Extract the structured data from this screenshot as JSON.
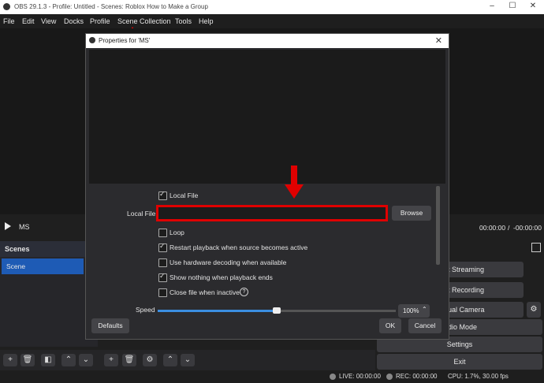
{
  "window": {
    "title": "OBS 29.1.3 - Profile: Untitled - Scenes: Roblox How to Make a Group",
    "min": "–",
    "max": "☐",
    "close": "✕"
  },
  "menubar": [
    "File",
    "Edit",
    "View",
    "Docks",
    "Profile",
    "Scene Collection",
    "Tools",
    "Help"
  ],
  "playbar": {
    "source": "MS",
    "time": "00:00:00",
    "sep": "/",
    "duration": "-00:00:00"
  },
  "scenes": {
    "header": "Scenes",
    "items": [
      "Scene"
    ]
  },
  "controls": {
    "start_streaming": "t Streaming",
    "start_recording": "t Recording",
    "virtual_camera": "ual Camera",
    "studio_mode": "udio Mode",
    "settings": "Settings",
    "exit": "Exit"
  },
  "status": {
    "live": "LIVE: 00:00:00",
    "rec": "REC: 00:00:00",
    "cpu": "CPU: 1.7%, 30.00 fps"
  },
  "dialog": {
    "title": "Properties for 'MS'",
    "local_file_checkbox": "Local File",
    "local_file_label": "Local File",
    "local_file_value": "",
    "browse": "Browse",
    "loop": "Loop",
    "restart": "Restart playback when source becomes active",
    "hw_decoding": "Use hardware decoding when available",
    "show_nothing": "Show nothing when playback ends",
    "close_inactive": "Close file when inactive",
    "speed_label": "Speed",
    "speed_value": "100%",
    "speed_percent": 50,
    "defaults": "Defaults",
    "ok": "OK",
    "cancel": "Cancel",
    "checks": {
      "local_file": true,
      "loop": false,
      "restart": true,
      "hw_decoding": false,
      "show_nothing": true,
      "close_inactive": false
    }
  },
  "colors": {
    "highlight": "#e00000",
    "selected_scene": "#1e5bb5",
    "slider": "#3b8ee0"
  }
}
